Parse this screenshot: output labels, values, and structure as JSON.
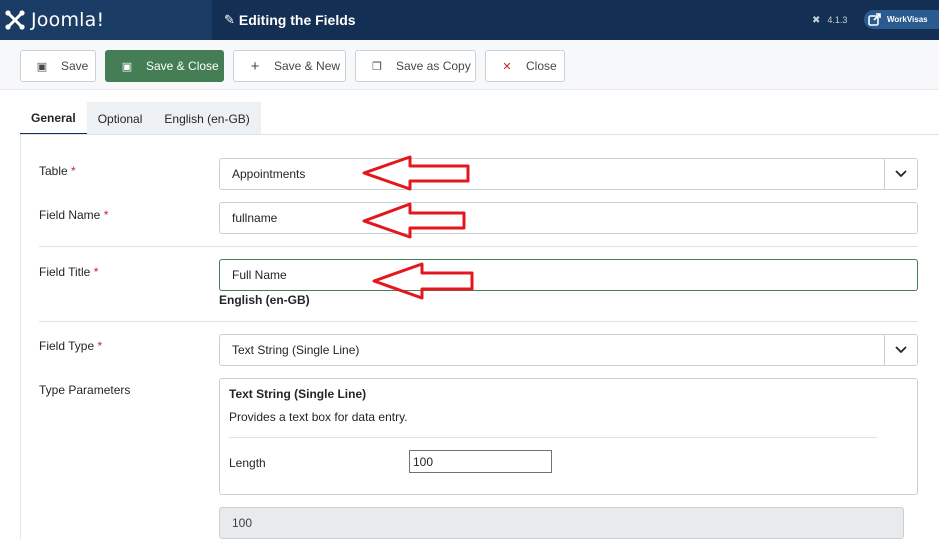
{
  "header": {
    "logo_text": "Joomla!",
    "page_title": "Editing the Fields",
    "version": "4.1.3",
    "site_name": "WorkVisas"
  },
  "toolbar": {
    "save": "Save",
    "save_close": "Save & Close",
    "save_new": "Save & New",
    "save_copy": "Save as Copy",
    "close": "Close"
  },
  "tabs": [
    "General",
    "Optional",
    "English (en-GB)"
  ],
  "form": {
    "table_label": "Table",
    "table_value": "Appointments",
    "field_name_label": "Field Name",
    "field_name_value": "fullname",
    "field_title_label": "Field Title",
    "field_title_value": "Full Name",
    "field_title_lang": "English (en-GB)",
    "field_type_label": "Field Type",
    "field_type_value": "Text String (Single Line)",
    "type_params_label": "Type Parameters",
    "required_mark": "*"
  },
  "type_params": {
    "title": "Text String (Single Line)",
    "description": "Provides a text box for data entry.",
    "length_label": "Length",
    "length_value": "100"
  },
  "disabled_value": "100",
  "colors": {
    "header_bg": "#132f53",
    "primary_green": "#457d54",
    "required_red": "#c52827",
    "annotation_red": "#e3171d"
  }
}
